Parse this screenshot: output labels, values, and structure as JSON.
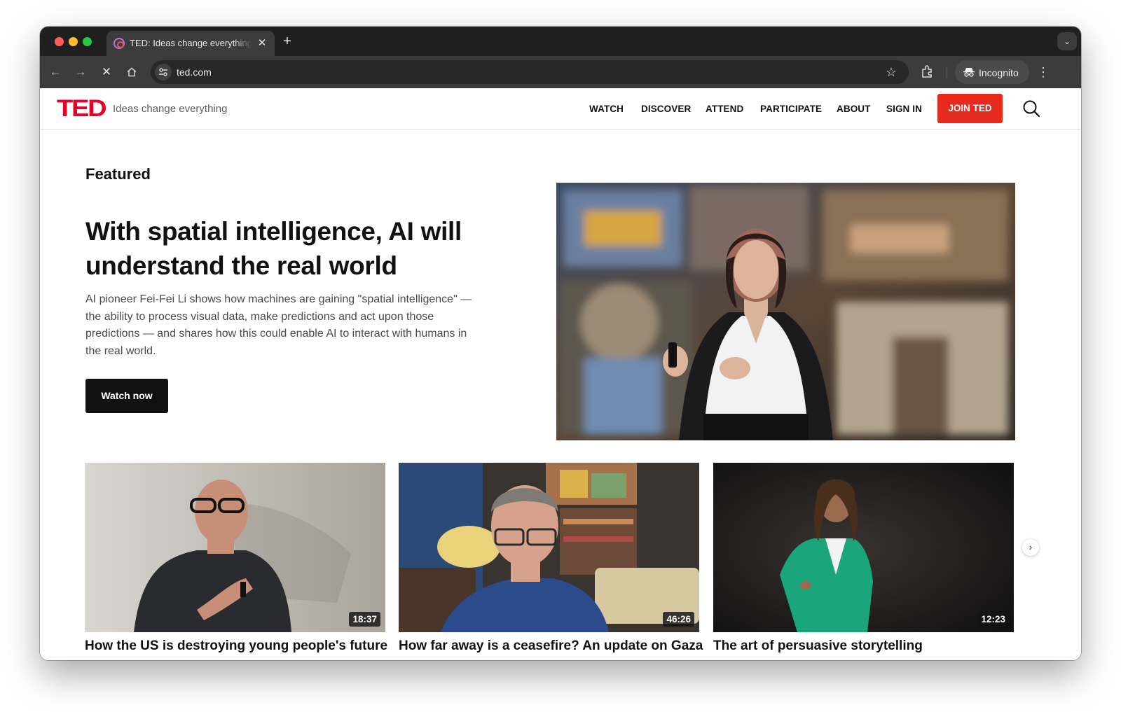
{
  "browser": {
    "tab_title": "TED: Ideas change everything",
    "url": "ted.com",
    "profile_label": "Incognito",
    "icons": [
      "back-arrow-icon",
      "forward-arrow-icon",
      "stop-loading-icon",
      "home-icon",
      "site-info-icon",
      "bookmark-star-icon",
      "extensions-icon",
      "incognito-icon",
      "more-menu-icon",
      "tab-search-icon"
    ]
  },
  "site": {
    "logo": "TED",
    "tagline": "Ideas change everything",
    "nav": [
      "WATCH",
      "DISCOVER",
      "ATTEND",
      "PARTICIPATE",
      "ABOUT",
      "SIGN IN"
    ],
    "join_label": "JOIN TED",
    "brand_color": "#e62b1e"
  },
  "featured": {
    "label": "Featured",
    "title": "With spatial intelligence, AI will understand the real world",
    "description": "AI pioneer Fei-Fei Li shows how machines are gaining \"spatial intelligence\" — the ability to process visual data, make predictions and act upon those predictions — and shares how this could enable AI to interact with humans in the real world.",
    "cta": "Watch now"
  },
  "talks": [
    {
      "duration": "18:37",
      "title": "How the US is destroying young people's future"
    },
    {
      "duration": "46:26",
      "title": "How far away is a ceasefire? An update on Gaza"
    },
    {
      "duration": "12:23",
      "title": "The art of persuasive storytelling"
    }
  ]
}
